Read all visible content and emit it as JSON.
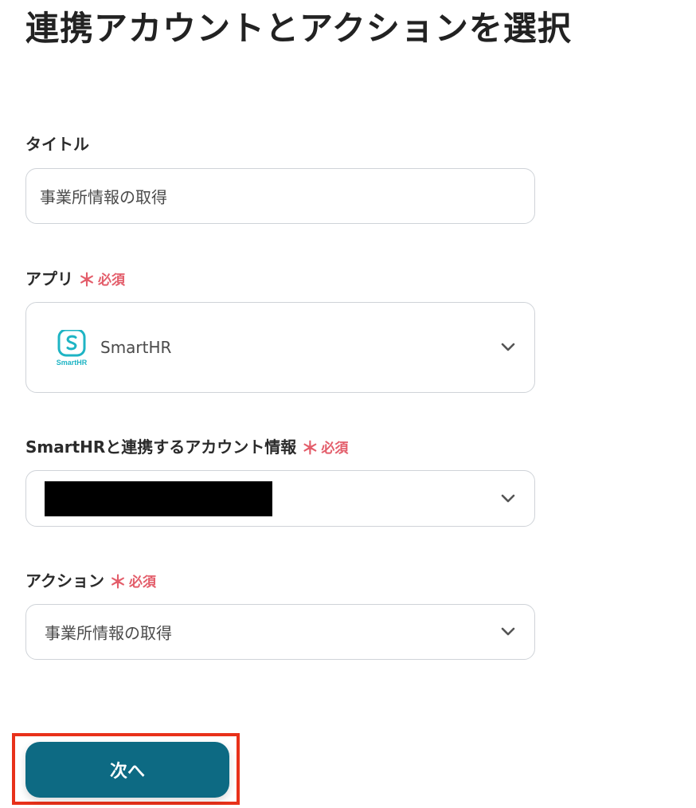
{
  "page": {
    "title": "連携アカウントとアクションを選択"
  },
  "form": {
    "required_mark": "＊",
    "required_label": "必須",
    "title_field": {
      "label": "タイトル",
      "value": "事業所情報の取得"
    },
    "app_field": {
      "label": "アプリ",
      "required": true,
      "selected_app": "SmartHR",
      "logo_caption": "SmartHR",
      "logo_color": "#1eb4c4"
    },
    "account_field": {
      "label": "SmartHRと連携するアカウント情報",
      "required": true,
      "value_redacted": true
    },
    "action_field": {
      "label": "アクション",
      "required": true,
      "value": "事業所情報の取得"
    }
  },
  "footer": {
    "next_label": "次へ",
    "next_color": "#0d6a83",
    "highlight_color": "#e8311a"
  }
}
